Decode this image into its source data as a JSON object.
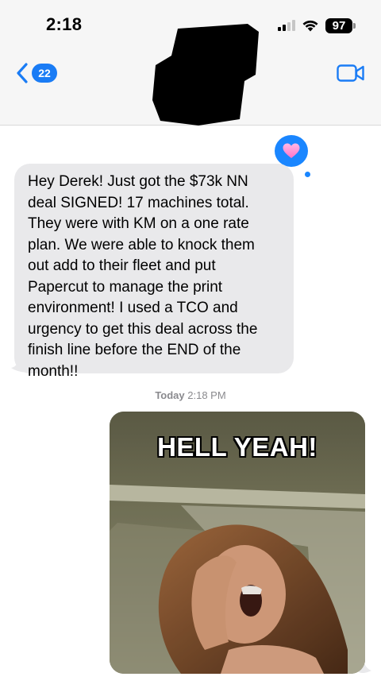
{
  "status_bar": {
    "time": "2:18",
    "battery": "97"
  },
  "nav": {
    "back_count": "22"
  },
  "messages": {
    "incoming_text": "Hey Derek! Just got the $73k NN deal SIGNED! 17 machines total. They were with KM on a one rate plan. We were able to knock them out add to their fleet and put Papercut to manage the print environment! I used a TCO and urgency to get this deal across the finish line before the END of the month!!",
    "tapback": "heart",
    "timestamp_day": "Today",
    "timestamp_time": "2:18 PM",
    "gif_caption": "HELL YEAH!"
  },
  "colors": {
    "accent": "#1a7cf5",
    "incoming_bubble": "#e9e9eb",
    "header_bg": "#f6f6f6"
  },
  "icons": [
    "back-chevron-icon",
    "facetime-video-icon",
    "wifi-icon",
    "cellular-signal-icon",
    "heart-tapback-icon"
  ]
}
